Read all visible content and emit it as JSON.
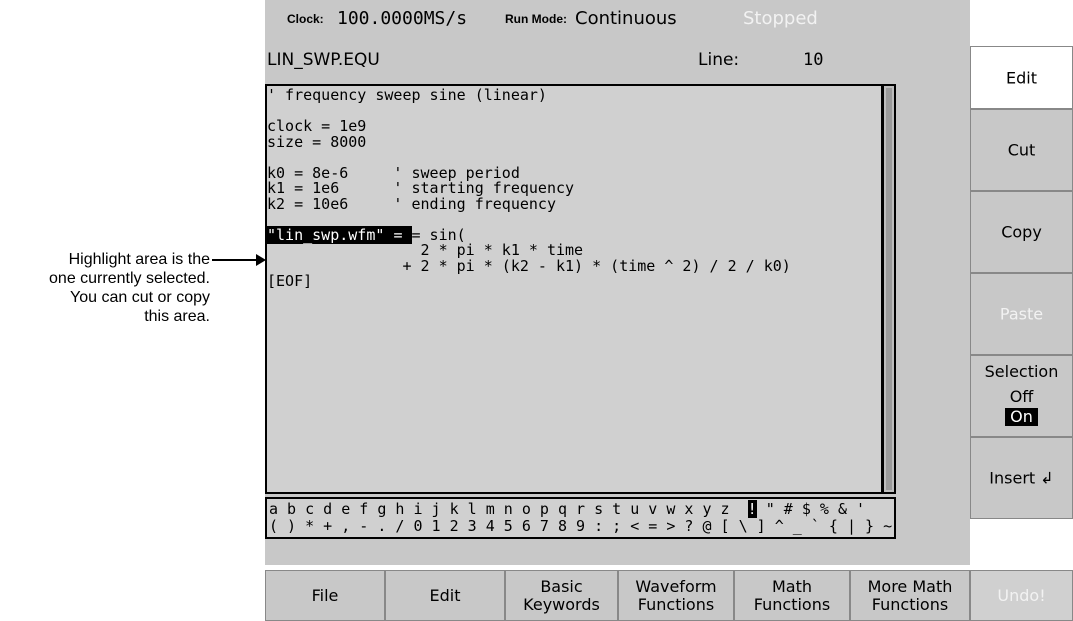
{
  "annotation": {
    "lines": [
      "Highlight area is the",
      "one currently selected.",
      "You can cut or copy",
      "this area."
    ]
  },
  "status_bar": {
    "clock_label": "Clock:",
    "clock_value": "100.0000MS/s",
    "run_mode_label": "Run Mode:",
    "run_mode_value": "Continuous",
    "state": "Stopped"
  },
  "editor": {
    "filename": "LIN_SWP.EQU",
    "line_label": "Line:",
    "line_value": "10",
    "code_lines": [
      "' frequency sweep sine (linear)",
      "",
      "clock = 1e9",
      "size = 8000",
      "",
      "k0 = 8e-6     ' sweep period",
      "k1 = 1e6      ' starting frequency",
      "k2 = 10e6     ' ending frequency",
      "",
      "= sin(",
      "                 2 * pi * k1 * time",
      "               + 2 * pi * (k2 - k1) * (time ^ 2) / 2 / k0)",
      "[EOF]"
    ],
    "highlighted_text": "\"lin_swp.wfm\" ",
    "charset_row1_pre": "a b c d e f g h i j k l m n o p q r s t u v w x y z  ",
    "charset_selected": "!",
    "charset_row1_post": " \" # $ % & '",
    "charset_row2": "( ) * + , - . / 0 1 2 3 4 5 6 7 8 9 : ; < = > ? @ [ \\ ] ^ _ ` { | } ~"
  },
  "side_menu": {
    "title": "Edit",
    "cut": "Cut",
    "copy": "Copy",
    "paste": "Paste",
    "selection_label": "Selection",
    "selection_off": "Off",
    "selection_on": "On",
    "insert": "Insert ↲"
  },
  "bottom_menu": {
    "file": "File",
    "edit": "Edit",
    "basic_keywords": [
      "Basic",
      "Keywords"
    ],
    "waveform_functions": [
      "Waveform",
      "Functions"
    ],
    "math_functions": [
      "Math",
      "Functions"
    ],
    "more_math_functions": [
      "More Math",
      "Functions"
    ],
    "undo": "Undo!"
  }
}
